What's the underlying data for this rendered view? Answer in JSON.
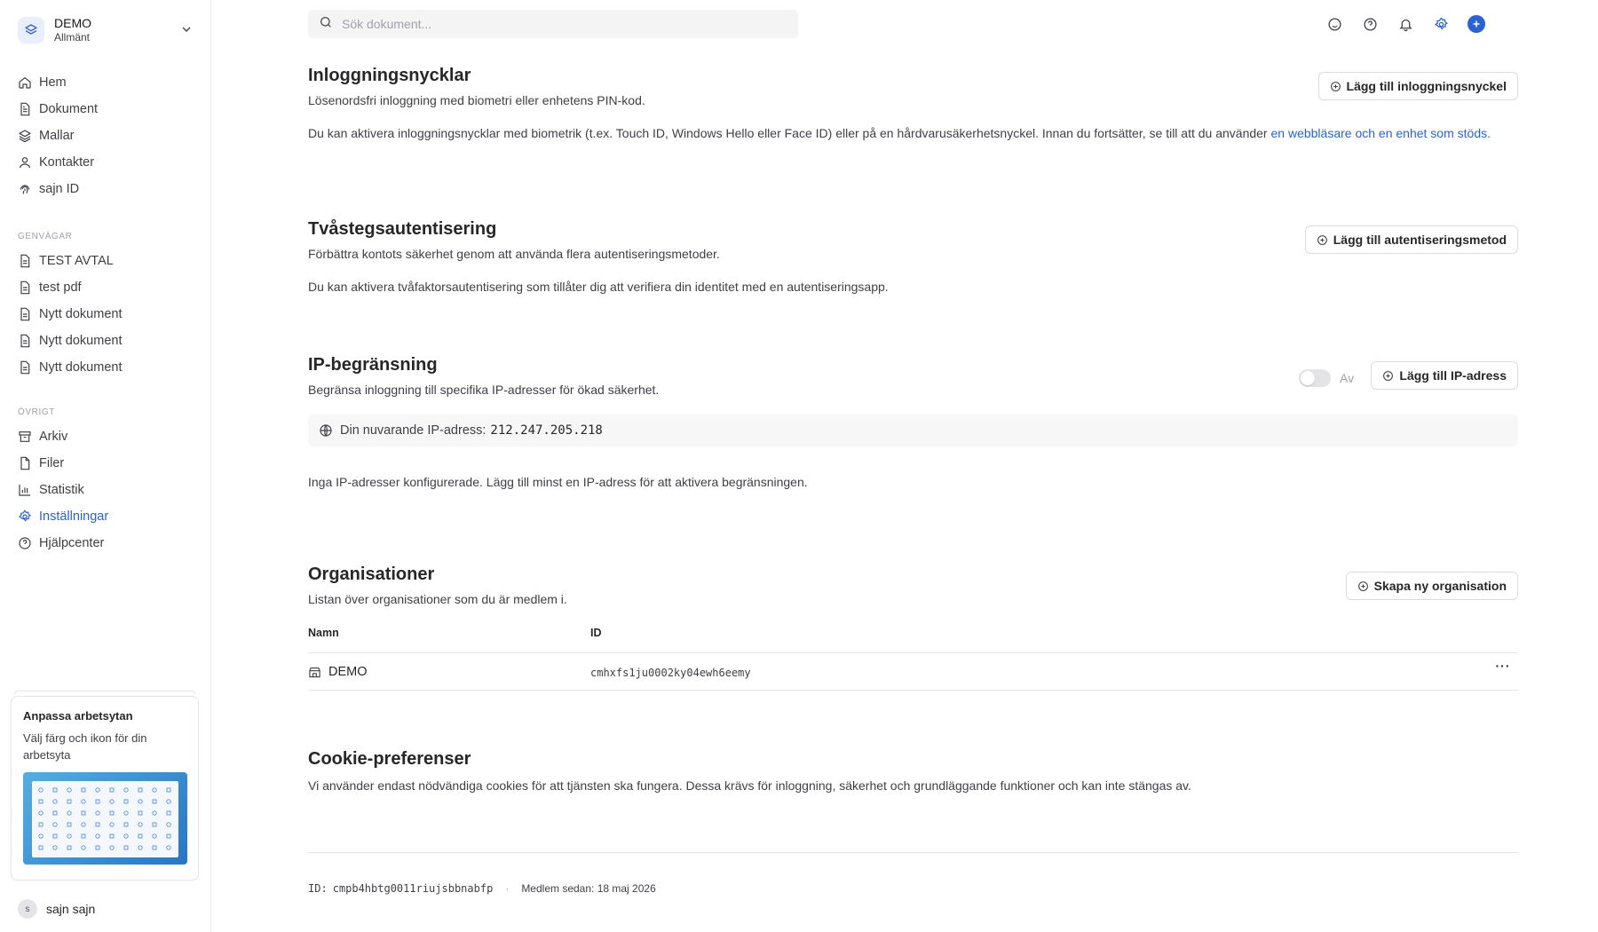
{
  "workspace": {
    "name": "DEMO",
    "subtitle": "Allmänt"
  },
  "nav": {
    "main": [
      {
        "label": "Hem",
        "icon": "home-icon"
      },
      {
        "label": "Dokument",
        "icon": "document-icon"
      },
      {
        "label": "Mallar",
        "icon": "layers-icon"
      },
      {
        "label": "Kontakter",
        "icon": "users-icon"
      },
      {
        "label": "sajn ID",
        "icon": "fingerprint-icon"
      }
    ],
    "shortcuts_label": "GENVÄGAR",
    "shortcuts": [
      {
        "label": "TEST AVTAL"
      },
      {
        "label": "test pdf"
      },
      {
        "label": "Nytt dokument"
      },
      {
        "label": "Nytt dokument"
      },
      {
        "label": "Nytt dokument"
      }
    ],
    "other_label": "ÖVRIGT",
    "other": [
      {
        "label": "Arkiv",
        "icon": "archive-icon"
      },
      {
        "label": "Filer",
        "icon": "file-icon"
      },
      {
        "label": "Statistik",
        "icon": "bar-chart-icon"
      },
      {
        "label": "Inställningar",
        "icon": "settings-icon",
        "active": true
      },
      {
        "label": "Hjälpcenter",
        "icon": "help-circle-icon"
      }
    ]
  },
  "promo": {
    "title": "Anpassa arbetsytan",
    "description": "Välj färg och ikon för din arbetsyta"
  },
  "user": {
    "initial": "s",
    "name": "sajn sajn"
  },
  "search": {
    "placeholder": "Sök dokument..."
  },
  "topbar_icons": [
    "smile-icon",
    "help-icon",
    "bell-icon",
    "gear-icon",
    "plus-icon"
  ],
  "passkeys": {
    "title": "Inloggningsnycklar",
    "subtitle": "Lösenordsfri inloggning med biometri eller enhetens PIN-kod.",
    "description": "Du kan aktivera inloggningsnycklar med biometrik (t.ex. Touch ID, Windows Hello eller Face ID) eller på en hårdvarusäkerhetsnyckel. Innan du fortsätter, se till att du använder",
    "link": "en webbläsare och en enhet som stöds.",
    "button": "Lägg till inloggningsnyckel"
  },
  "twofa": {
    "title": "Tvåstegsautentisering",
    "subtitle": "Förbättra kontots säkerhet genom att använda flera autentiseringsmetoder.",
    "description": "Du kan aktivera tvåfaktorsautentisering som tillåter dig att verifiera din identitet med en autentiseringsapp.",
    "button": "Lägg till autentiseringsmetod"
  },
  "ip": {
    "title": "IP-begränsning",
    "subtitle": "Begränsa inloggning till specifika IP-adresser för ökad säkerhet.",
    "toggle_label": "Av",
    "toggle_on": false,
    "button": "Lägg till IP-adress",
    "current_label": "Din nuvarande IP-adress:",
    "current_ip": "212.247.205.218",
    "empty": "Inga IP-adresser konfigurerade. Lägg till minst en IP-adress för att aktivera begränsningen."
  },
  "orgs": {
    "title": "Organisationer",
    "subtitle": "Listan över organisationer som du är medlem i.",
    "button": "Skapa ny organisation",
    "columns": [
      "Namn",
      "ID"
    ],
    "rows": [
      {
        "name": "DEMO",
        "id": "cmhxfs1ju0002ky04ewh6eemy"
      }
    ]
  },
  "cookies": {
    "title": "Cookie-preferenser",
    "description": "Vi använder endast nödvändiga cookies för att tjänsten ska fungera. Dessa krävs för inloggning, säkerhet och grundläggande funktioner och kan inte stängas av."
  },
  "footer": {
    "id_label": "ID:",
    "id_value": "cmpb4hbtg0011riujsbbnabfp",
    "separator": "·",
    "member_since": "Medlem sedan: 18 maj 2026"
  },
  "colors": {
    "accent": "#2a62d6",
    "text": "#27272a",
    "muted": "#3f3f46",
    "border": "#e4e4e7"
  }
}
